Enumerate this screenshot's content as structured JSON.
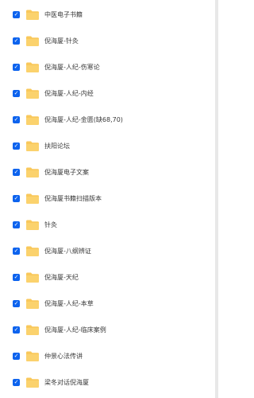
{
  "colors": {
    "accent": "#0d63ee",
    "folder": "#f9c85b",
    "text": "#3a3a3a"
  },
  "file_list": {
    "items": [
      {
        "name": "中医电子书籍",
        "checked": true,
        "icon": "folder-icon"
      },
      {
        "name": "倪海厦-针灸",
        "checked": true,
        "icon": "folder-icon"
      },
      {
        "name": "倪海厦-人纪-伤寒论",
        "checked": true,
        "icon": "folder-icon"
      },
      {
        "name": "倪海厦-人纪-内经",
        "checked": true,
        "icon": "folder-icon"
      },
      {
        "name": "倪海厦-人纪-金匮(缺68,70)",
        "checked": true,
        "icon": "folder-icon"
      },
      {
        "name": "扶阳论坛",
        "checked": true,
        "icon": "folder-icon"
      },
      {
        "name": "倪海厦电子文案",
        "checked": true,
        "icon": "folder-icon"
      },
      {
        "name": "倪海厦书籍扫描版本",
        "checked": true,
        "icon": "folder-icon"
      },
      {
        "name": "针灸",
        "checked": true,
        "icon": "folder-icon"
      },
      {
        "name": "倪海厦-八纲辨证",
        "checked": true,
        "icon": "folder-icon"
      },
      {
        "name": "倪海厦-天纪",
        "checked": true,
        "icon": "folder-icon"
      },
      {
        "name": "倪海厦-人纪-本草",
        "checked": true,
        "icon": "folder-icon"
      },
      {
        "name": "倪海厦-人纪-临床案例",
        "checked": true,
        "icon": "folder-icon"
      },
      {
        "name": "仲景心法传讲",
        "checked": true,
        "icon": "folder-icon"
      },
      {
        "name": "梁冬对话倪海厦",
        "checked": true,
        "icon": "folder-icon"
      }
    ]
  }
}
